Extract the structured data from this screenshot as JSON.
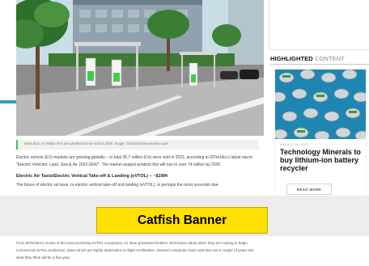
{
  "article": {
    "caption": "More than 74 million EVs are predicted to be sold in 2030. Image: ©Vicchan/Dreamstime.com",
    "paragraph_1": "Electric vehicle (EV) markets are growing globally – in total 35.7 million EVs were sold in 2021, according to IDTechEx's latest report \"Electric Vehicles: Land, Sea & Air 2022-2042\". The market analyst predicts this will rise to over 74 million by 2030.",
    "heading": "Electric Air Taxis/Electric Vertical Take-off & Landing (eVTOL) – ~$1Wh",
    "paragraph_2": "The future of electric air taxis, or electric vertical take-off and landing (eVTOL), is perhaps the most uncertain due",
    "paragraph_3": "From IDTechEx's review of the most promising eVTOL companies, 21 have presented timeline information about when they are looking to begin commercial eVTOL production, plans which are highly dependent on flight certification. Several companies have said they are a couple of years into what they think will be a five-year"
  },
  "sidebar": {
    "section_title_bold": "HIGHLIGHTED",
    "section_title_light": "CONTENT",
    "card": {
      "date": "AUGUST 16, 2022",
      "title": "Technology Minerals to buy lithium-ion battery recycler",
      "read_more": "READ MORE"
    }
  },
  "catfish": {
    "label": "Catfish Banner"
  },
  "colors": {
    "accent": "#2aa0b8",
    "caption_bar": "#58b05a",
    "banner": "#ffe000"
  }
}
